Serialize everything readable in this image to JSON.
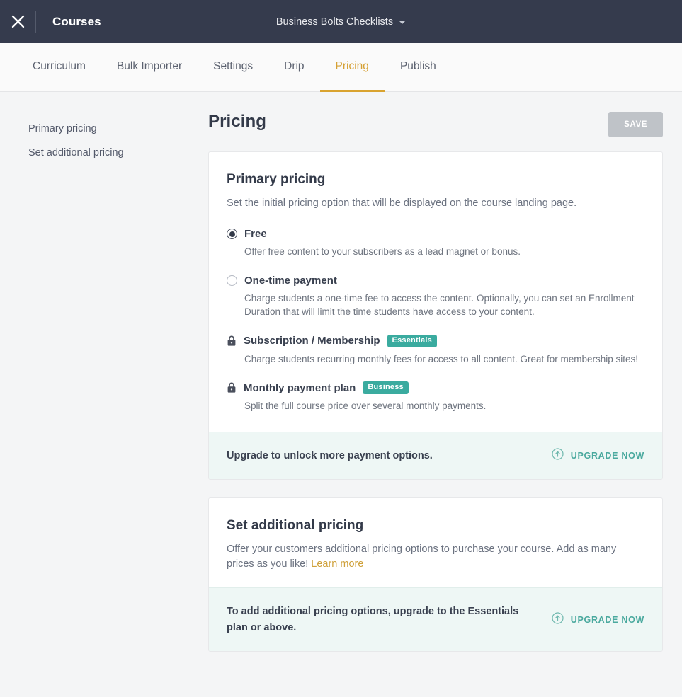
{
  "topbar": {
    "close_icon": "close-icon",
    "title": "Courses",
    "course_name": "Business Bolts Checklists",
    "caret_icon": "chevron-down-icon",
    "background_color": "#353b4d"
  },
  "tabs": [
    {
      "label": "Curriculum",
      "active": false
    },
    {
      "label": "Bulk Importer",
      "active": false
    },
    {
      "label": "Settings",
      "active": false
    },
    {
      "label": "Drip",
      "active": false
    },
    {
      "label": "Pricing",
      "active": true
    },
    {
      "label": "Publish",
      "active": false
    }
  ],
  "tab_accent_color": "#d9a32f",
  "sidebar": {
    "items": [
      {
        "label": "Primary pricing"
      },
      {
        "label": "Set additional pricing"
      }
    ]
  },
  "main": {
    "page_title": "Pricing",
    "save_label": "SAVE",
    "save_disabled": true
  },
  "primary_pricing": {
    "title": "Primary pricing",
    "subtitle": "Set the initial pricing option that will be displayed on the course landing page.",
    "options": [
      {
        "label": "Free",
        "description": "Offer free content to your subscribers as a lead magnet or bonus.",
        "control": "radio",
        "selected": true,
        "locked": false,
        "badge": ""
      },
      {
        "label": "One-time payment",
        "description": "Charge students a one-time fee to access the content. Optionally, you can set an Enrollment Duration that will limit the time students have access to your content.",
        "control": "radio",
        "selected": false,
        "locked": false,
        "badge": ""
      },
      {
        "label": "Subscription / Membership",
        "description": "Charge students recurring monthly fees for access to all content. Great for membership sites!",
        "control": "lock",
        "selected": false,
        "locked": true,
        "badge": "Essentials"
      },
      {
        "label": "Monthly payment plan",
        "description": "Split the full course price over several monthly payments.",
        "control": "lock",
        "selected": false,
        "locked": true,
        "badge": "Business"
      }
    ],
    "upgrade_banner": {
      "text": "Upgrade to unlock more payment options.",
      "action_label": "UPGRADE NOW",
      "icon": "arrow-up-circle-icon"
    }
  },
  "additional_pricing": {
    "title": "Set additional pricing",
    "subtitle_part1": "Offer your customers additional pricing options to purchase your course. Add as many prices as you like!",
    "link_label": "Learn more",
    "upgrade_banner": {
      "text": "To add additional pricing options, upgrade to the Essentials plan or above.",
      "action_label": "UPGRADE NOW",
      "icon": "arrow-up-circle-icon"
    }
  },
  "colors": {
    "badge_teal": "#3aab9f",
    "upgrade_teal": "#4aa99e",
    "banner_bg": "#eef7f5",
    "gold": "#cfa13b",
    "page_bg": "#f4f5f6"
  }
}
